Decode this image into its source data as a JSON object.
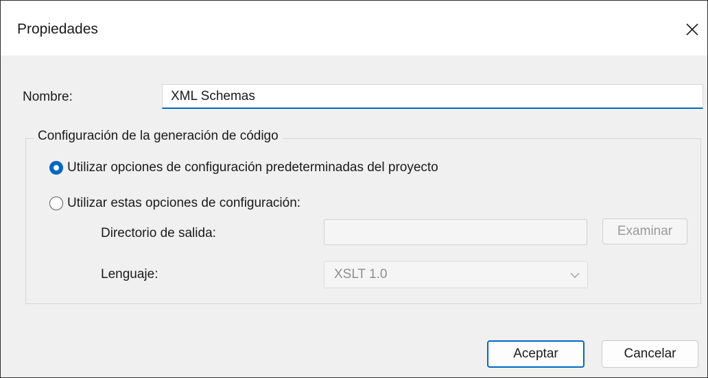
{
  "window": {
    "title": "Propiedades",
    "close_icon": "close-icon"
  },
  "name_field": {
    "label": "Nombre:",
    "value": "XML Schemas"
  },
  "code_generation": {
    "group_title": "Configuración de la generación de código",
    "options": [
      {
        "label": "Utilizar opciones de configuración predeterminadas del proyecto",
        "selected": true
      },
      {
        "label": "Utilizar estas opciones de configuración:",
        "selected": false
      }
    ],
    "output_directory": {
      "label": "Directorio de salida:",
      "value": "",
      "browse_label": "Examinar",
      "disabled": true
    },
    "language": {
      "label": "Lenguaje:",
      "selected": "XSLT 1.0",
      "disabled": true
    }
  },
  "buttons": {
    "ok_label": "Aceptar",
    "cancel_label": "Cancelar"
  },
  "colors": {
    "accent": "#0067c0",
    "dialog_background": "#f0f0f0",
    "disabled_text": "#9a9a9a"
  }
}
